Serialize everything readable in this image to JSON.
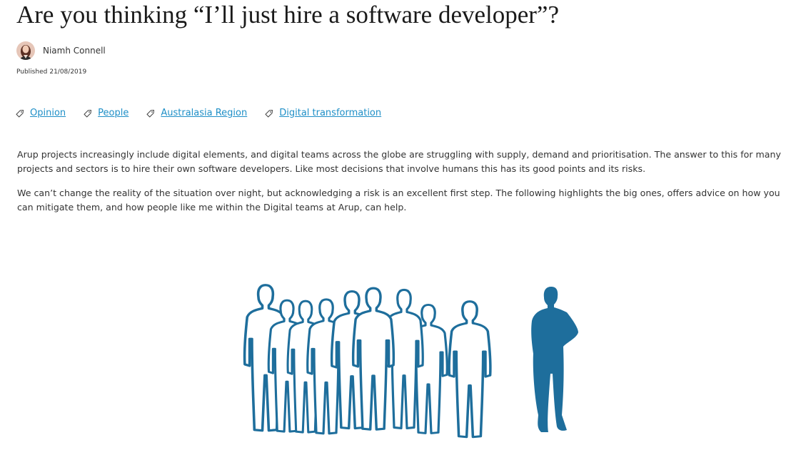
{
  "article": {
    "title": "Are you thinking “I’ll just hire a software developer”?",
    "author": {
      "name": "Niamh Connell"
    },
    "published": {
      "label": "Published",
      "date": "21/08/2019"
    },
    "tags": [
      {
        "label": "Opinion",
        "icon": "tag-icon"
      },
      {
        "label": "People",
        "icon": "tag-icon"
      },
      {
        "label": "Australasia Region",
        "icon": "tag-icon"
      },
      {
        "label": "Digital transformation",
        "icon": "tag-icon"
      }
    ],
    "paragraphs": [
      "Arup projects increasingly include digital elements, and digital teams across the globe are struggling with supply, demand and prioritisation. The answer to this for many projects and sectors is to hire their own software developers. Like most decisions that involve humans this has its good points and its risks.",
      "We can’t change the reality of the situation over night, but acknowledging a risk is an excellent first step. The following highlights the big ones, offers advice on how you can mitigate them, and how people like me within the Digital teams at Arup, can help."
    ],
    "hero_image": {
      "subject": "outlined crowd of silhouettes beside a lone solid silhouette"
    }
  },
  "colors": {
    "link": "#1f8fc7",
    "text": "#333333",
    "title": "#1a1a1a",
    "illustration": "#1e6e9c"
  }
}
